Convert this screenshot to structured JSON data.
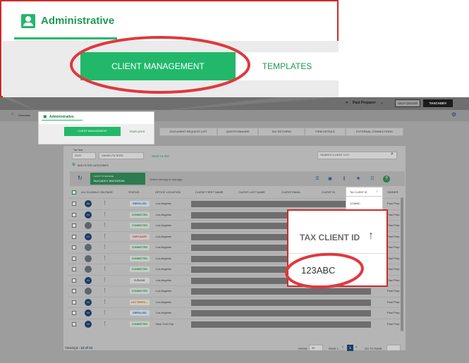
{
  "top": {
    "user": "Paul Preparer",
    "help": "HELP CENTER",
    "brand": "TAXCADDY"
  },
  "nav": {
    "overview": "Overview",
    "admin": "Administrative"
  },
  "tabs": [
    "CLIENT MANAGEMENT",
    "TEMPLATES",
    "DOCUMENT REQUEST LIST",
    "QUESTIONNAIRE",
    "TAX RETURNS",
    "FIRM DETAILS",
    "EXTERNAL CONNECTIONS"
  ],
  "filters": {
    "tax_year_label": "Tax Year",
    "tax_year": "2020",
    "saved_filters": "SAVED FILTERS",
    "save_filter": "SAVE FILTER",
    "search_placeholder": "SEARCH CLIENT LIST",
    "add_filter": "ADD FILTER CATEGORIES"
  },
  "toolbar": {
    "action_small": "I WANT TO MANAGE",
    "action": "TAXCADDY INVITATION",
    "select_msg": "Select client(s) to manage."
  },
  "columns": [
    "ALL ELIGIBLE ON PAGE",
    "STATUS",
    "OFFICE LOCATION",
    "CLIENT FIRST NAME",
    "CLIENT LAST NAME",
    "CLIENT EMAIL",
    "CLIENT ID",
    "TAX CLIENT ID",
    "OWNER"
  ],
  "small_pop": {
    "header": "TAX CLIENT ID",
    "value": "123ABC"
  },
  "rows": [
    {
      "initials": "AA",
      "photo": false,
      "status": "ENROLLED",
      "status_class": "st-enrolled",
      "location": "Los Angeles",
      "owner": "Paul Prep"
    },
    {
      "initials": "YY",
      "photo": false,
      "status": "CONNECTED",
      "status_class": "st-connected",
      "location": "Los Angeles",
      "owner": "Paul Prep"
    },
    {
      "initials": "",
      "photo": true,
      "status": "CONNECTED",
      "status_class": "st-connected",
      "location": "Los Angeles",
      "owner": "Paul Prep"
    },
    {
      "initials": "YY",
      "photo": false,
      "status": "DUPLICATE",
      "status_class": "st-duplicate",
      "location": "Los Angeles",
      "owner": "Paul Prep"
    },
    {
      "initials": "",
      "photo": true,
      "status": "CONNECTED",
      "status_class": "st-connected",
      "location": "Los Angeles",
      "owner": "Paul Prep"
    },
    {
      "initials": "",
      "photo": true,
      "status": "CONNECTED",
      "status_class": "st-connected",
      "location": "Los Angeles",
      "owner": "Paul Prep"
    },
    {
      "initials": "",
      "photo": true,
      "status": "CONNECTED",
      "status_class": "st-connected",
      "location": "Los Angeles",
      "owner": "Paul Prep"
    },
    {
      "initials": "YY",
      "photo": false,
      "status": "E-FILING",
      "status_class": "st-filing",
      "location": "Los Angeles",
      "owner": "Paul Prep"
    },
    {
      "initials": "",
      "photo": true,
      "status": "CONNECTED",
      "status_class": "st-connected",
      "location": "Los Angeles",
      "owner": "Paul Prep"
    },
    {
      "initials": "YY",
      "photo": false,
      "status": "NOT ENROL...",
      "status_class": "st-notenrolled",
      "location": "Los Angeles",
      "owner": "Paul Prep"
    },
    {
      "initials": "YY",
      "photo": false,
      "status": "ENROLLED",
      "status_class": "st-enrolled",
      "location": "Los Angeles",
      "owner": "Paul Prep"
    },
    {
      "initials": "YY",
      "photo": false,
      "status": "CONNECTED",
      "status_class": "st-connected",
      "location": "New York City",
      "owner": "Paul Prep"
    }
  ],
  "footer": {
    "viewing_prefix": "Viewing",
    "viewing": "1 - 12 of 12",
    "show": "SHOW",
    "show_val": "30",
    "page": "PAGE 1",
    "page_num": "1",
    "goto": "GO TO PAGE"
  },
  "zoom_top": {
    "title": "Administrative",
    "tab_active": "CLIENT MANAGEMENT",
    "tab_other": "TEMPLATES"
  },
  "zoom_right": {
    "header": "TAX CLIENT ID",
    "value": "123ABC"
  },
  "colors": {
    "accent": "#22b86a",
    "highlight": "#cc2b2b",
    "navy": "#1f3d63"
  }
}
